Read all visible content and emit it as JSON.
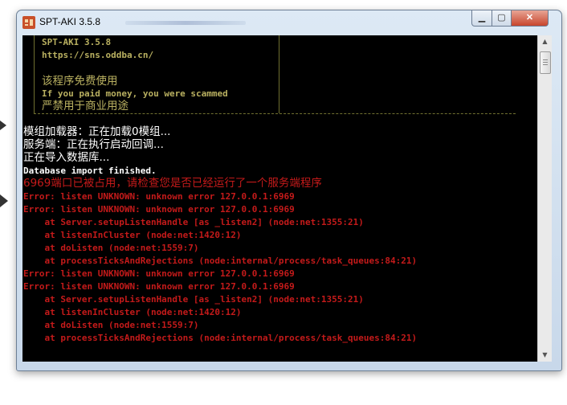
{
  "window": {
    "title": "SPT-AKI 3.5.8",
    "controls": {
      "minimize": "▁",
      "maximize": "▢",
      "close": "✕"
    }
  },
  "console": {
    "banner": [
      {
        "text": "SPT-AKI 3.5.8",
        "color": "#b9b060"
      },
      {
        "text": "https://sns.oddba.cn/",
        "color": "#b9b060"
      },
      {
        "text": "该程序免费使用",
        "color": "#b9b060"
      },
      {
        "text": "If you paid money, you were scammed",
        "color": "#b9b060"
      },
      {
        "text": "严禁用于商业用途",
        "color": "#b9b060"
      }
    ],
    "lines": [
      {
        "text": "模组加载器：正在加载0模组...",
        "color": "#ffffff"
      },
      {
        "text": "服务端：正在执行启动回调...",
        "color": "#ffffff"
      },
      {
        "text": "正在导入数据库...",
        "color": "#ffffff"
      },
      {
        "text": "Database import finished.",
        "color": "#ffffff"
      },
      {
        "text": "6969端口已被占用，请检查您是否已经运行了一个服务端程序",
        "color": "#c41a1a"
      },
      {
        "text": "Error: listen UNKNOWN: unknown error 127.0.0.1:6969",
        "color": "#c41a1a"
      },
      {
        "text": "Error: listen UNKNOWN: unknown error 127.0.0.1:6969",
        "color": "#c41a1a"
      },
      {
        "text": "    at Server.setupListenHandle [as _listen2] (node:net:1355:21)",
        "color": "#c41a1a"
      },
      {
        "text": "    at listenInCluster (node:net:1420:12)",
        "color": "#c41a1a"
      },
      {
        "text": "    at doListen (node:net:1559:7)",
        "color": "#c41a1a"
      },
      {
        "text": "    at processTicksAndRejections (node:internal/process/task_queues:84:21)",
        "color": "#c41a1a"
      },
      {
        "text": "Error: listen UNKNOWN: unknown error 127.0.0.1:6969",
        "color": "#c41a1a"
      },
      {
        "text": "Error: listen UNKNOWN: unknown error 127.0.0.1:6969",
        "color": "#c41a1a"
      },
      {
        "text": "    at Server.setupListenHandle [as _listen2] (node:net:1355:21)",
        "color": "#c41a1a"
      },
      {
        "text": "    at listenInCluster (node:net:1420:12)",
        "color": "#c41a1a"
      },
      {
        "text": "    at doListen (node:net:1559:7)",
        "color": "#c41a1a"
      },
      {
        "text": "    at processTicksAndRejections (node:internal/process/task_queues:84:21)",
        "color": "#c41a1a"
      }
    ]
  },
  "scrollbar": {
    "up_icon": "▲",
    "down_icon": "▼"
  },
  "colors": {
    "console_bg": "#000000",
    "error": "#c41a1a",
    "banner": "#b9b060",
    "info": "#ffffff"
  }
}
